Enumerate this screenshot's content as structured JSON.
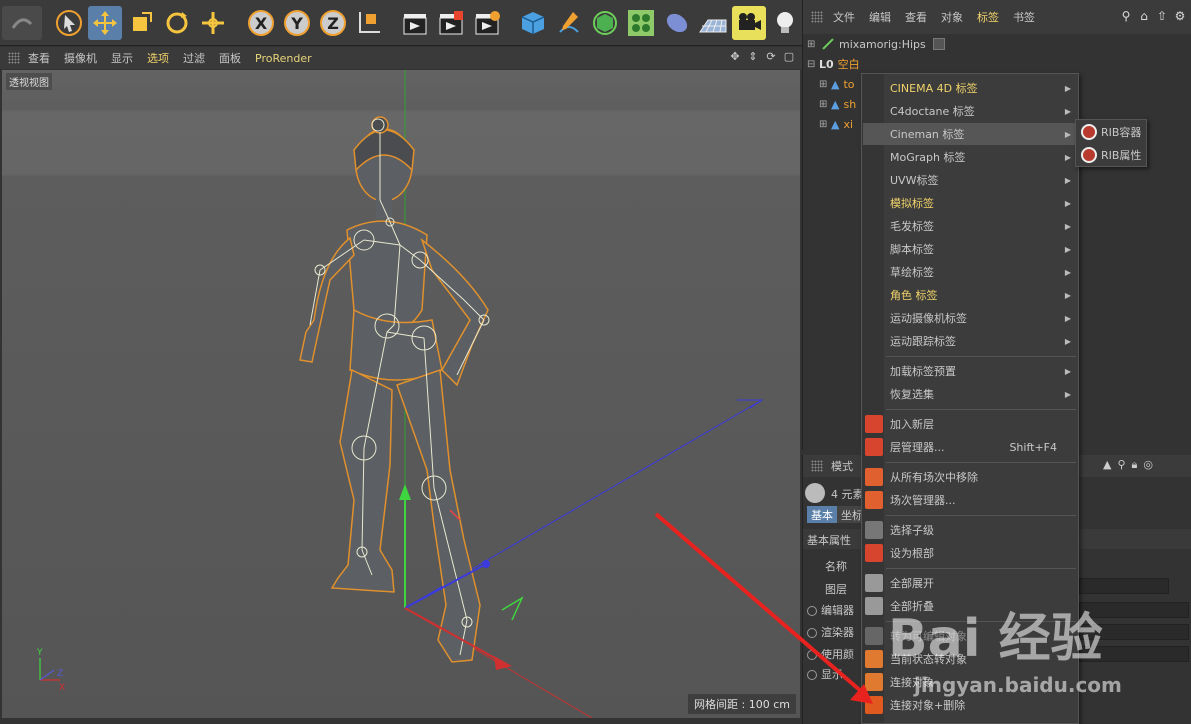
{
  "viewport_menu": {
    "items": [
      "查看",
      "摄像机",
      "显示",
      "选项",
      "过滤",
      "面板",
      "ProRender"
    ],
    "active_index": 3
  },
  "viewport": {
    "label": "透视视图",
    "grid_info": "网格间距 : 100 cm",
    "axis_labels": {
      "x": "X",
      "y": "Y",
      "z": "Z"
    }
  },
  "object_manager": {
    "menu": [
      "文件",
      "编辑",
      "查看",
      "对象",
      "标签",
      "书签"
    ],
    "active_index": 4,
    "rows": [
      {
        "name": "mixamorig:Hips",
        "color": "#c8c8c8"
      },
      {
        "name": "空白",
        "color": "#f0a030"
      },
      {
        "name": "to",
        "color": "#f0a030"
      },
      {
        "name": "sh",
        "color": "#f0a030"
      },
      {
        "name": "xi",
        "color": "#f0a030"
      }
    ]
  },
  "attribute_manager": {
    "mode_label": "模式",
    "count_label": "4 元素",
    "tabs": [
      "基本",
      "坐标"
    ],
    "section": "基本属性",
    "fields": [
      "名称",
      "图层"
    ],
    "options": [
      "编辑器",
      "渲染器",
      "使用颜",
      "显示"
    ]
  },
  "context_menu": {
    "items": [
      {
        "label": "CINEMA 4D 标签",
        "highlight": true,
        "submenu": true
      },
      {
        "label": "C4doctane 标签",
        "submenu": true
      },
      {
        "label": "Cineman 标签",
        "submenu": true,
        "active": true
      },
      {
        "label": "MoGraph 标签",
        "submenu": true
      },
      {
        "label": "UVW标签",
        "submenu": true
      },
      {
        "label": "模拟标签",
        "highlight": true,
        "submenu": true
      },
      {
        "label": "毛发标签",
        "submenu": true
      },
      {
        "label": "脚本标签",
        "submenu": true
      },
      {
        "label": "草绘标签",
        "submenu": true
      },
      {
        "label": "角色 标签",
        "highlight": true,
        "submenu": true
      },
      {
        "label": "运动摄像机标签",
        "submenu": true
      },
      {
        "label": "运动跟踪标签",
        "submenu": true
      },
      {
        "label": "加载标签预置",
        "submenu": true
      },
      {
        "label": "恢复选集",
        "submenu": true
      },
      {
        "label": "加入新层",
        "icon": "add-layer-icon"
      },
      {
        "label": "层管理器...",
        "shortcut": "Shift+F4",
        "icon": "layer-manager-icon"
      },
      {
        "label": "从所有场次中移除",
        "icon": "remove-take-icon"
      },
      {
        "label": "场次管理器...",
        "icon": "take-manager-icon"
      },
      {
        "label": "选择子级",
        "icon": "select-children-icon"
      },
      {
        "label": "设为根部",
        "icon": "set-root-icon"
      },
      {
        "label": "全部展开",
        "icon": "expand-all-icon"
      },
      {
        "label": "全部折叠",
        "icon": "collapse-all-icon"
      },
      {
        "label": "转为可编辑对象",
        "disabled": true,
        "icon": "make-editable-icon"
      },
      {
        "label": "当前状态转对象",
        "icon": "current-state-icon"
      },
      {
        "label": "连接对象",
        "icon": "connect-icon"
      },
      {
        "label": "连接对象+删除",
        "icon": "connect-delete-icon"
      }
    ]
  },
  "submenu": {
    "items": [
      "RIB容器",
      "RIB属性"
    ]
  },
  "watermark": {
    "brand": "Bai 经验",
    "url": "jingyan.baidu.com"
  },
  "colors": {
    "accent": "#f0d36a",
    "selection": "#5a7fa8",
    "orange": "#f0a030",
    "arrow_red": "#e8231f"
  }
}
